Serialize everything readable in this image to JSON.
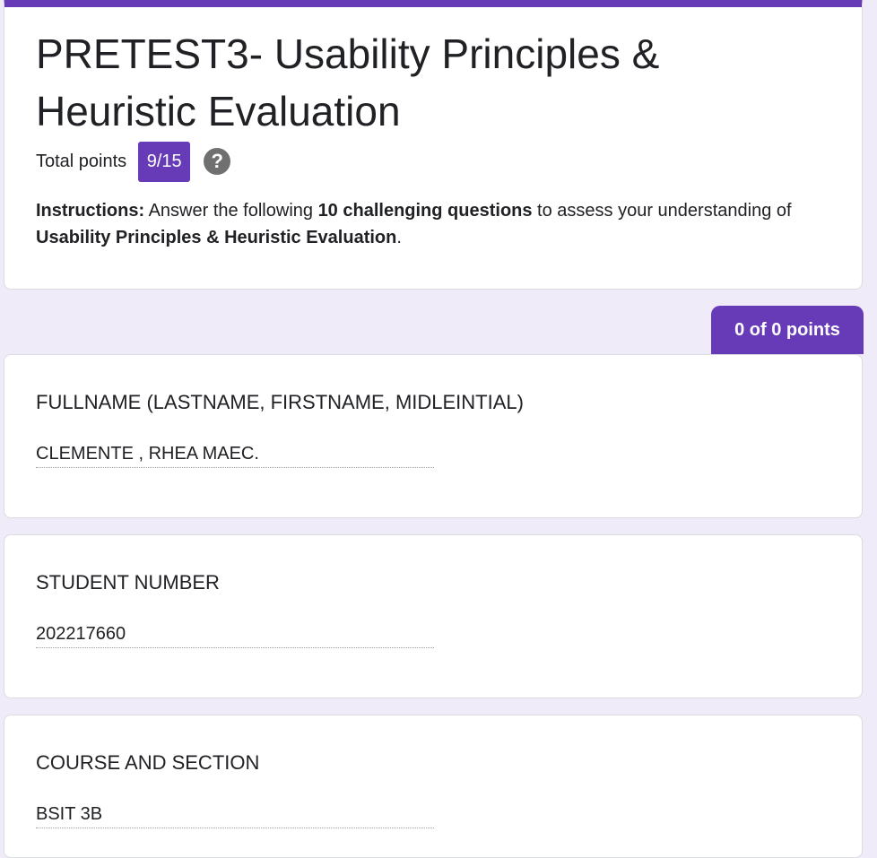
{
  "header": {
    "title": "PRETEST3- Usability Principles & Heuristic Evaluation",
    "total_points_label": "Total points",
    "total_points_value": "9/15",
    "help_icon": "help-circle-icon",
    "instructions": {
      "lead": "Instructions:",
      "text1": " Answer the following ",
      "bold1": "10 challenging questions",
      "text2": " to assess your understanding of ",
      "bold2": "Usability Principles & Heuristic Evaluation",
      "text3": "."
    }
  },
  "section": {
    "points_badge": "0 of 0 points"
  },
  "questions": [
    {
      "title": "FULLNAME (LASTNAME, FIRSTNAME, MIDLEINTIAL)",
      "answer": "CLEMENTE , RHEA MAEC."
    },
    {
      "title": "STUDENT NUMBER",
      "answer": "202217660"
    },
    {
      "title": "COURSE AND SECTION",
      "answer": "BSIT 3B"
    }
  ],
  "colors": {
    "accent": "#673ab7",
    "background": "#efebf8",
    "card": "#ffffff"
  }
}
